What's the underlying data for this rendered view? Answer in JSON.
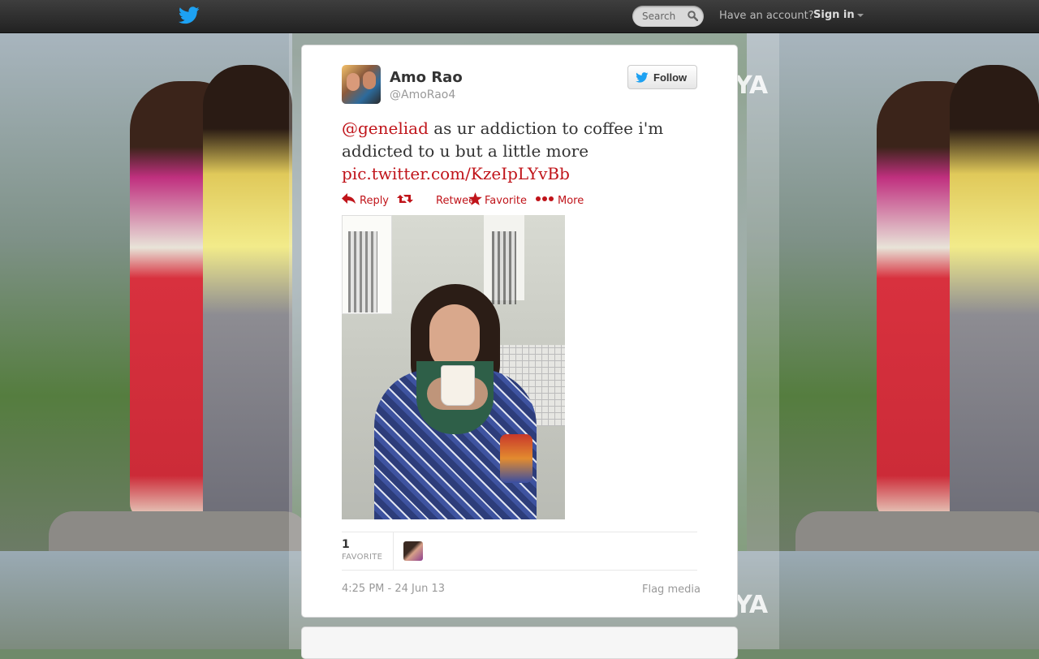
{
  "topbar": {
    "logo_icon": "twitter-bird-icon",
    "search": {
      "placeholder": "Search",
      "icon": "search-icon"
    },
    "account_text": "Have an account?",
    "signin_label": "Sign in"
  },
  "tweet": {
    "author": {
      "fullname": "Amo Rao",
      "username": "@AmoRao4"
    },
    "follow_label": "Follow",
    "text": {
      "mention": "@geneliad",
      "body": " as ur addiction to coffee i'm addicted to u but a little more ",
      "link": "pic.twitter.com/KzeIpLYvBb"
    },
    "actions": [
      {
        "label": "Reply",
        "icon": "reply-icon"
      },
      {
        "label": "Retweet",
        "icon": "retweet-icon"
      },
      {
        "label": "Favorite",
        "icon": "star-icon"
      },
      {
        "label": "More",
        "icon": "more-dots-icon"
      }
    ],
    "stats": {
      "favorite_count": "1",
      "favorite_label": "FAVORITE"
    },
    "timestamp": "4:25 PM - 24 Jun 13",
    "flag_media_label": "Flag media"
  },
  "background": {
    "watermark_text": "YA"
  },
  "colors": {
    "link": "#c0141a",
    "topbar": "#2b2b2b",
    "twitter_blue": "#1da1f2"
  }
}
